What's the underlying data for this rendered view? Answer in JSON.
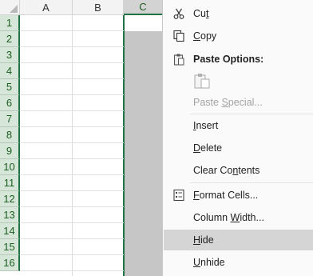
{
  "columns": [
    "A",
    "B",
    "C"
  ],
  "rows": [
    "1",
    "2",
    "3",
    "4",
    "5",
    "6",
    "7",
    "8",
    "9",
    "10",
    "11",
    "12",
    "13",
    "14",
    "15",
    "16"
  ],
  "selected_column": "C",
  "colors": {
    "accent": "#217346",
    "selected_fill": "#c6c6c6",
    "row_header_fill": "#d6e6d8",
    "menu_hover": "#d5d5d5"
  },
  "menu": {
    "cut": {
      "pre": "Cu",
      "u": "t",
      "post": "",
      "icon": "scissors-icon"
    },
    "copy": {
      "pre": "",
      "u": "C",
      "post": "opy",
      "icon": "copy-icon"
    },
    "paste_options": {
      "label": "Paste Options:",
      "icon": "paste-icon"
    },
    "paste_special": {
      "pre": "Paste ",
      "u": "S",
      "post": "pecial...",
      "disabled": true
    },
    "insert": {
      "pre": "",
      "u": "I",
      "post": "nsert"
    },
    "delete": {
      "pre": "",
      "u": "D",
      "post": "elete"
    },
    "clear_contents": {
      "pre": "Clear Co",
      "u": "n",
      "post": "tents"
    },
    "format_cells": {
      "pre": "",
      "u": "F",
      "post": "ormat Cells...",
      "icon": "format-cells-icon"
    },
    "column_width": {
      "pre": "Column ",
      "u": "W",
      "post": "idth..."
    },
    "hide": {
      "pre": "",
      "u": "H",
      "post": "ide",
      "highlighted": true
    },
    "unhide": {
      "pre": "",
      "u": "U",
      "post": "nhide"
    }
  }
}
